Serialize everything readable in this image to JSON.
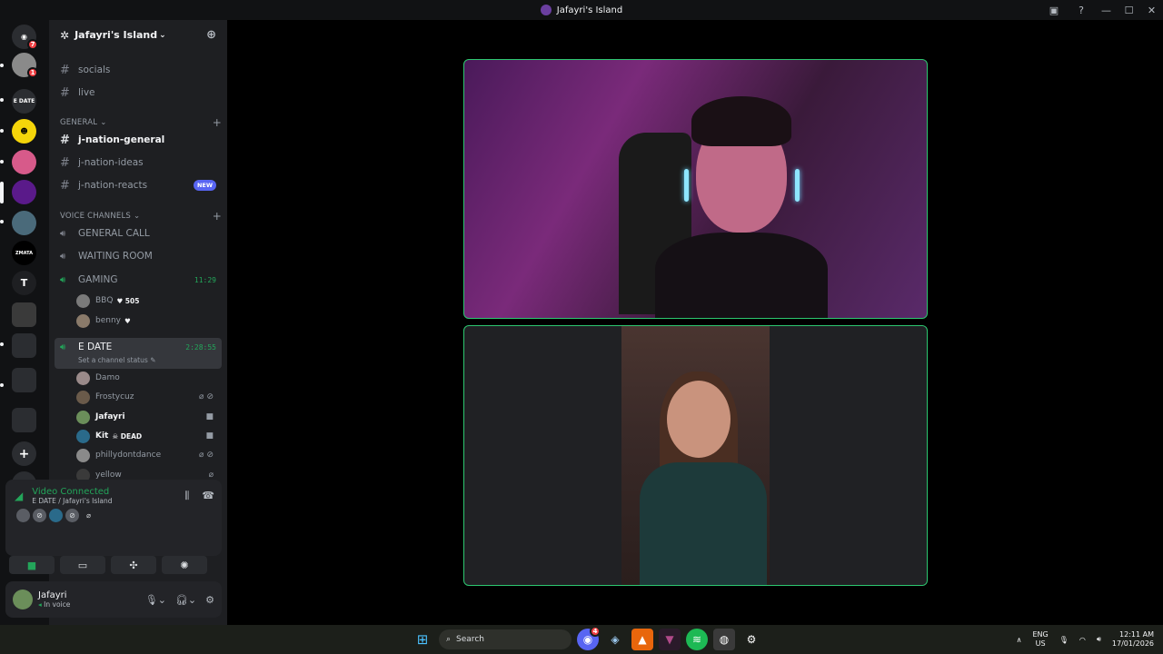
{
  "window": {
    "title": "Jafayri's Island"
  },
  "server": {
    "name": "Jafayri's Island"
  },
  "guild_rail": {
    "home_badge": "7",
    "dm_badge": "1",
    "labels": [
      "E DATE",
      "ZMATA",
      "T"
    ]
  },
  "text_channels": [
    {
      "name": "socials"
    },
    {
      "name": "live"
    }
  ],
  "general_category": {
    "label": "GENERAL",
    "channels": [
      {
        "name": "j-nation-general"
      },
      {
        "name": "j-nation-ideas"
      },
      {
        "name": "j-nation-reacts",
        "badge": "NEW"
      }
    ]
  },
  "voice_category": {
    "label": "VOICE CHANNELS",
    "channels": [
      {
        "name": "GENERAL CALL"
      },
      {
        "name": "WAITING ROOM"
      },
      {
        "name": "GAMING",
        "timer": "11:29"
      }
    ],
    "gaming_users": [
      {
        "name": "BBQ",
        "status": "505"
      },
      {
        "name": "benny",
        "status": ""
      }
    ],
    "edate": {
      "name": "E DATE",
      "timer": "2:28:55",
      "status_placeholder": "Set a channel status"
    },
    "edate_users": [
      {
        "name": "Damo",
        "status": ""
      },
      {
        "name": "Frostycuz",
        "status": ""
      },
      {
        "name": "Jafayri",
        "status": ""
      },
      {
        "name": "Kit",
        "status": "DEAD"
      },
      {
        "name": "phillydontdance",
        "status": ""
      },
      {
        "name": "yellow",
        "status": ""
      }
    ]
  },
  "voice_panel": {
    "status": "Video Connected",
    "location": "E DATE / Jafayri's Island"
  },
  "user_panel": {
    "name": "Jafayri",
    "status": "In voice"
  },
  "taskbar": {
    "search_label": "Search",
    "discord_badge": "4",
    "lang_top": "ENG",
    "lang_bottom": "US",
    "time": "12:11 AM",
    "date": "17/01/2026"
  },
  "colors": {
    "accent_green": "#23a55a",
    "tile_border": "#2dc770",
    "new_badge": "#5865f2"
  }
}
